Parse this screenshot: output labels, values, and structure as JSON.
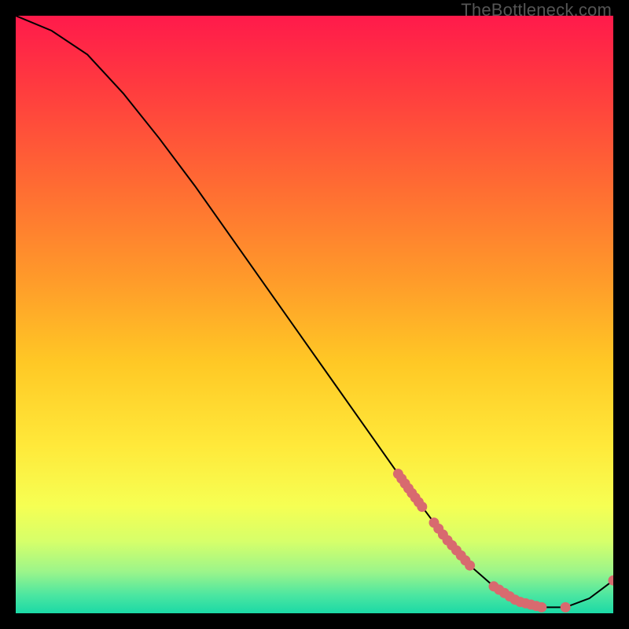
{
  "attribution": "TheBottleneck.com",
  "chart_data": {
    "type": "line",
    "title": "",
    "xlabel": "",
    "ylabel": "",
    "xlim": [
      0,
      100
    ],
    "ylim": [
      0,
      100
    ],
    "x": [
      0,
      6,
      12,
      18,
      24,
      30,
      36,
      42,
      48,
      54,
      60,
      66,
      72,
      76,
      80,
      84,
      88,
      92,
      96,
      100
    ],
    "y": [
      100,
      97.5,
      93.5,
      87,
      79.5,
      71.5,
      63,
      54.5,
      46,
      37.5,
      29,
      20.5,
      12.5,
      8,
      4.5,
      2,
      1,
      1,
      2.5,
      5.5
    ],
    "dot_clusters": [
      {
        "start_x": 64,
        "end_x": 68,
        "count": 8
      },
      {
        "start_x": 70,
        "end_x": 76,
        "count": 9
      },
      {
        "start_x": 80,
        "end_x": 88,
        "count": 10
      },
      {
        "start_x": 92,
        "end_x": 92.5,
        "count": 1
      },
      {
        "start_x": 100,
        "end_x": 100,
        "count": 1
      }
    ],
    "gradient_stops": [
      {
        "offset": 0.0,
        "color": "#ff1a4b"
      },
      {
        "offset": 0.12,
        "color": "#ff3b3f"
      },
      {
        "offset": 0.28,
        "color": "#ff6a33"
      },
      {
        "offset": 0.44,
        "color": "#ff9a2a"
      },
      {
        "offset": 0.58,
        "color": "#ffc825"
      },
      {
        "offset": 0.72,
        "color": "#ffe93a"
      },
      {
        "offset": 0.82,
        "color": "#f6ff53"
      },
      {
        "offset": 0.88,
        "color": "#d6ff6a"
      },
      {
        "offset": 0.93,
        "color": "#9cf58a"
      },
      {
        "offset": 0.97,
        "color": "#4be6a1"
      },
      {
        "offset": 1.0,
        "color": "#1bd9a6"
      }
    ],
    "dot_color": "#d86a6f",
    "line_color": "#000000"
  }
}
